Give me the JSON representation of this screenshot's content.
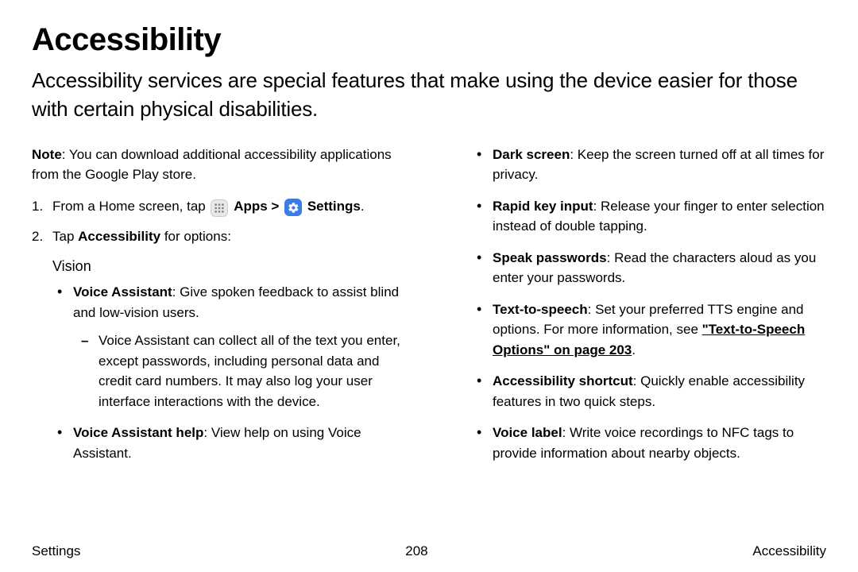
{
  "title": "Accessibility",
  "intro": "Accessibility services are special features that make using the device easier for those with certain physical disabilities.",
  "note_label": "Note",
  "note_text": ": You can download additional accessibility applications from the Google Play store.",
  "step1_num": "1.",
  "step1_prefix": "From a Home screen, tap ",
  "step1_apps": "Apps",
  "step1_sep": " > ",
  "step1_settings": "Settings",
  "step1_suffix": ".",
  "step2_num": "2.",
  "step2_prefix": "Tap ",
  "step2_bold": "Accessibility",
  "step2_suffix": " for options:",
  "vision_heading": "Vision",
  "va_label": "Voice Assistant",
  "va_text": ": Give spoken feedback to assist blind and low-vision users.",
  "va_sub": "Voice Assistant can collect all of the text you enter, except passwords, including personal data and credit card numbers. It may also log your user interface interactions with the device.",
  "vah_label": "Voice Assistant help",
  "vah_text": ": View help on using Voice Assistant.",
  "dark_label": "Dark screen",
  "dark_text": ": Keep the screen turned off at all times for privacy.",
  "rapid_label": "Rapid key input",
  "rapid_text": ": Release your finger to enter selection instead of double tapping.",
  "speak_label": "Speak passwords",
  "speak_text": ": Read the characters aloud as you enter your passwords.",
  "tts_label": "Text-to-speech",
  "tts_text": ": Set your preferred TTS engine and options. For more information, see ",
  "tts_link": "\"Text-to-Speech Options\" on page 203",
  "tts_suffix": ".",
  "shortcut_label": "Accessibility shortcut",
  "shortcut_text": ": Quickly enable accessibility features in two quick steps.",
  "voicelabel_label": "Voice label",
  "voicelabel_text": ": Write voice recordings to NFC tags to provide information about nearby objects.",
  "footer_left": "Settings",
  "footer_center": "208",
  "footer_right": "Accessibility"
}
